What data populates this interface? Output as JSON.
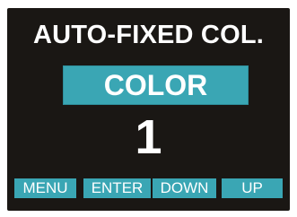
{
  "display": {
    "title": "AUTO-FIXED COL.",
    "mode_label": "COLOR",
    "value": "1"
  },
  "softkeys": [
    {
      "label": "MENU"
    },
    {
      "label": "ENTER"
    },
    {
      "label": "DOWN"
    },
    {
      "label": "UP"
    }
  ],
  "colors": {
    "screen_background": "#1a1714",
    "accent": "#3aa6b4",
    "text": "#ffffff"
  }
}
